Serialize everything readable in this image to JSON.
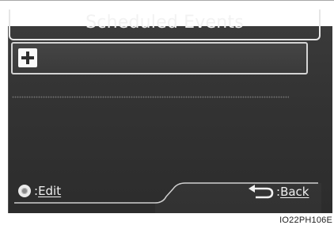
{
  "header": {
    "title": "Scheduled Events"
  },
  "list": {
    "add_icon": "plus-icon"
  },
  "footer": {
    "edit_key": ":",
    "edit_label": "Edit",
    "edit_icon": "knob-icon",
    "back_key": ":",
    "back_label": "Back",
    "back_icon": "return-arrow-icon"
  },
  "caption": "IO22PH106E",
  "colors": {
    "screen_bg": "#333333",
    "text": "#f2f2f2",
    "frame": "#e6e6e6"
  }
}
